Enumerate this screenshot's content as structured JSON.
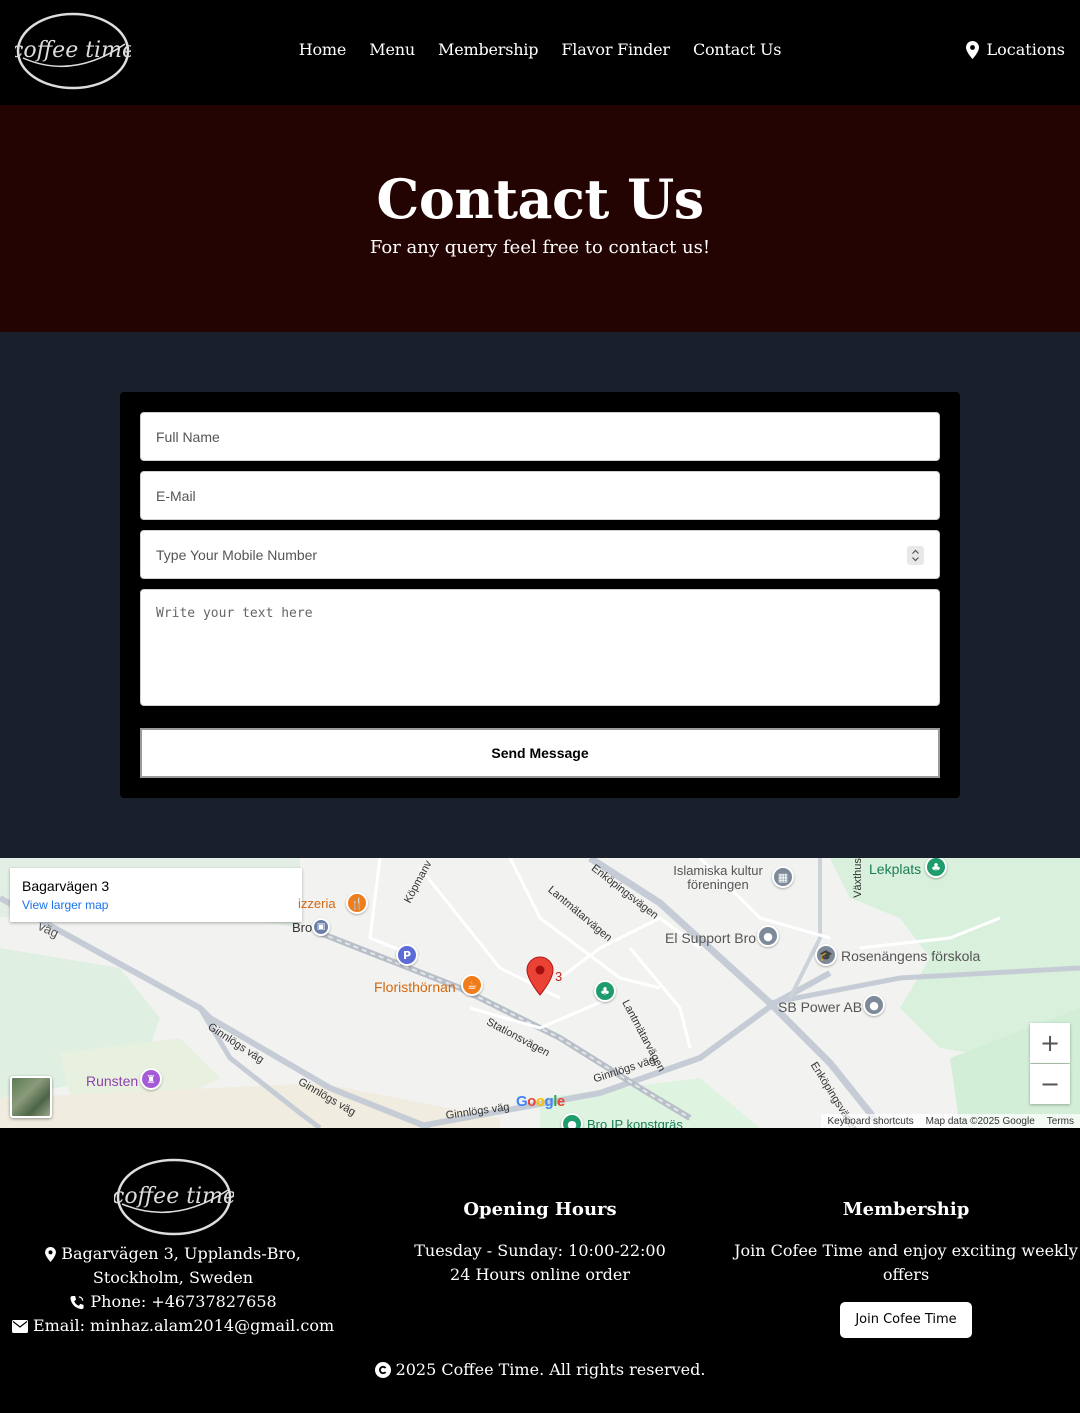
{
  "brand": {
    "logo_text": "coffee time"
  },
  "nav": {
    "items": [
      {
        "label": "Home"
      },
      {
        "label": "Menu"
      },
      {
        "label": "Membership"
      },
      {
        "label": "Flavor Finder"
      },
      {
        "label": "Contact Us"
      }
    ],
    "locations_label": "Locations"
  },
  "hero": {
    "title": "Contact Us",
    "subtitle": "For any query feel free to contact us!"
  },
  "form": {
    "name_placeholder": "Full Name",
    "email_placeholder": "E-Mail",
    "phone_placeholder": "Type Your Mobile Number",
    "message_placeholder": "Write your text here",
    "submit_label": "Send Message"
  },
  "map": {
    "place_name": "Bagarvägen 3",
    "larger_map_label": "View larger map",
    "marker_label": "3",
    "labels": {
      "islamiska": "Islamiska kultur föreningen",
      "lekplats": "Lekplats",
      "vaxthus": "Växthus",
      "pizzeria": "izzeria",
      "bro": "Bro",
      "kopmanv": "Köpmanv",
      "enkopingsvagen_top": "Enköpingsvägen",
      "lantmatarvagen_1": "Lantmätarvägen",
      "el_support": "El Support Bro",
      "rosenangens": "Rosenängens förskola",
      "floristhornan": "Floristhörnan",
      "lantmatarvagen_2": "Lantmätarvägen",
      "sb_power": "SB Power AB",
      "stationsvagen": "Stationsvägen",
      "ginnlogs_vag_1": "Ginnlögs väg",
      "ginnlogs_vag_2": "Ginnlögs väg",
      "ginnlogs_vag_3": "Ginnlögs väg",
      "ginnlogs_vag_4": "Ginnlögs väg",
      "enkopingsvagen_bottom": "Enköpingsvägen",
      "runsten": "Runsten",
      "bro_ip": "Bro IP konstgräs",
      "vag_left": "väg"
    },
    "zoom_in": "+",
    "zoom_out": "−",
    "google_logo": "Google",
    "footer": {
      "shortcuts": "Keyboard shortcuts",
      "data": "Map data ©2025 Google",
      "terms": "Terms"
    }
  },
  "footer": {
    "address": "Bagarvägen 3, Upplands-Bro, Stockholm, Sweden",
    "phone": "Phone: +46737827658",
    "email": "Email: minhaz.alam2014@gmail.com",
    "hours_title": "Opening Hours",
    "hours_line1": "Tuesday - Sunday: 10:00-22:00",
    "hours_line2": "24 Hours online order",
    "membership_title": "Membership",
    "membership_text": "Join Cofee Time and enjoy exciting weekly offers",
    "join_label": "Join Cofee Time",
    "copyright": "2025 Coffee Time. All rights reserved."
  }
}
